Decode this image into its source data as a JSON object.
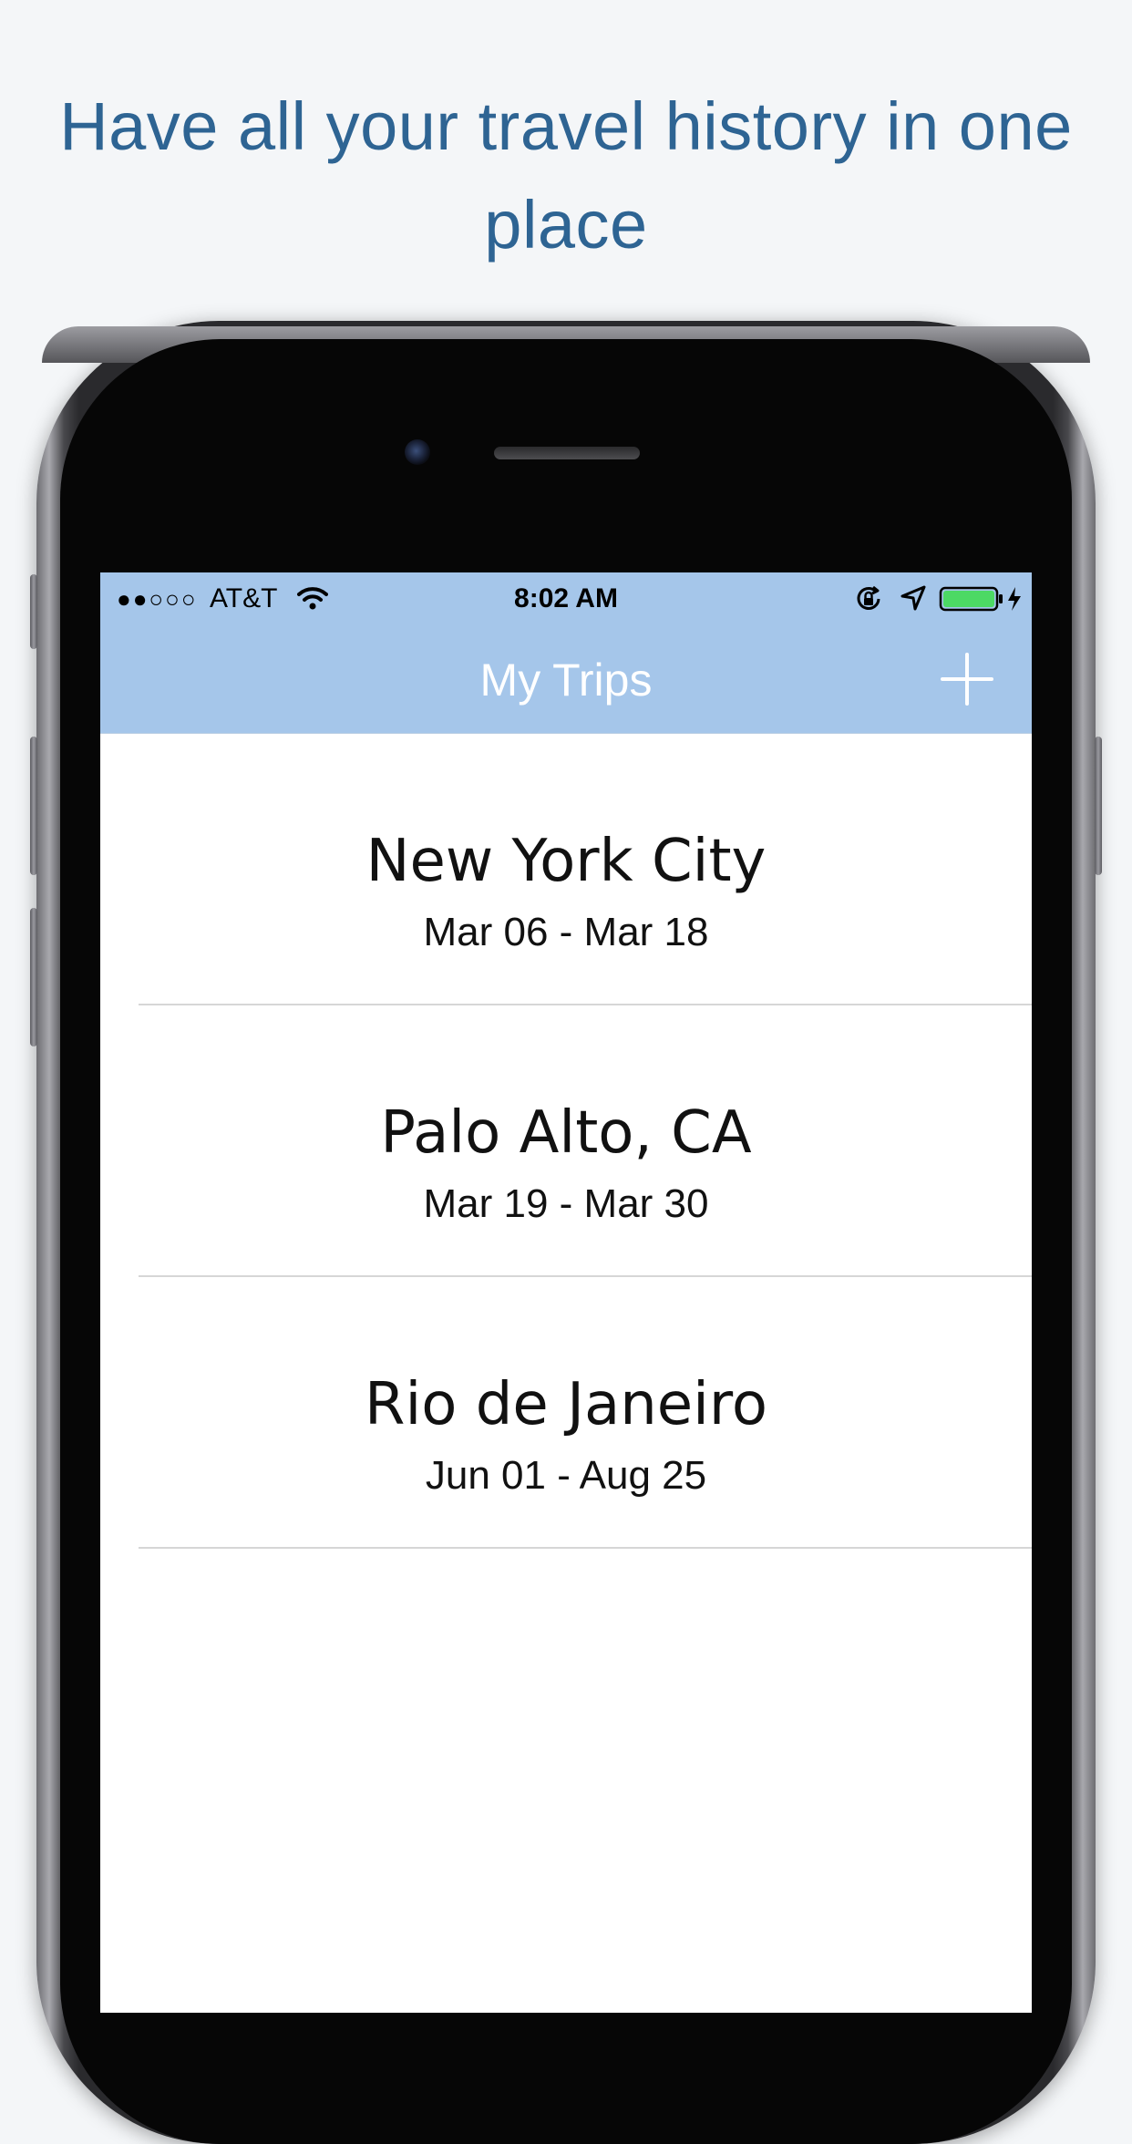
{
  "headline": "Have all your travel history in one place",
  "status_bar": {
    "signal": "●●○○○",
    "carrier": "AT&T",
    "time": "8:02 AM",
    "battery_color": "#4cd964"
  },
  "nav": {
    "title": "My Trips",
    "add_icon": "plus-icon",
    "background_color": "#a5c6ea"
  },
  "trips": [
    {
      "city": "New York City",
      "dates": "Mar 06 - Mar 18"
    },
    {
      "city": "Palo Alto, CA",
      "dates": "Mar 19 - Mar 30"
    },
    {
      "city": "Rio de Janeiro",
      "dates": "Jun 01 - Aug 25"
    }
  ],
  "colors": {
    "page_background": "#f4f6f8",
    "headline_color": "#2e6493"
  }
}
